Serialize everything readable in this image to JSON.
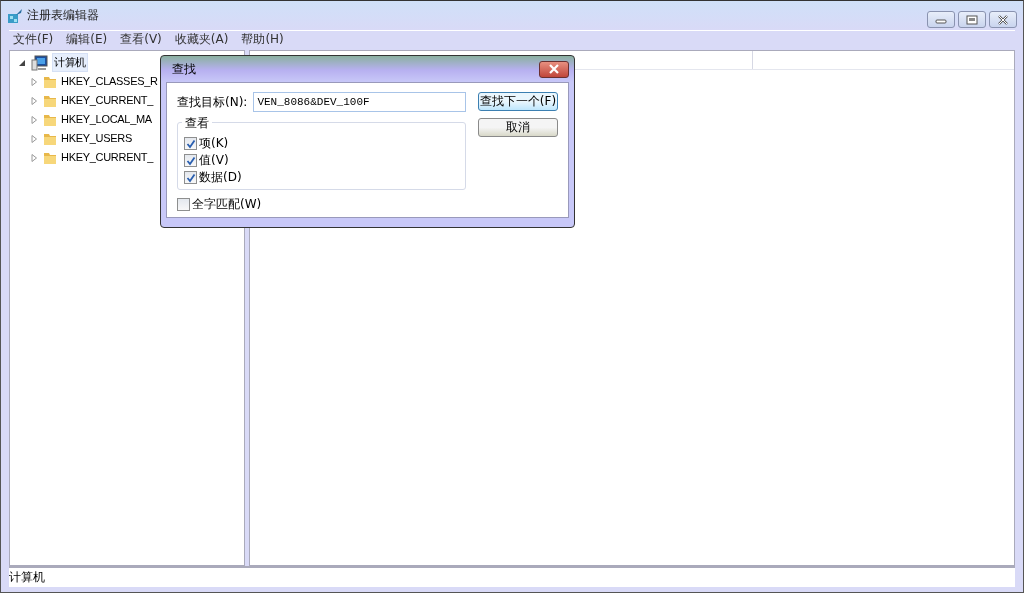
{
  "window": {
    "title": "注册表编辑器"
  },
  "menu": [
    "文件(F)",
    "编辑(E)",
    "查看(V)",
    "收藏夹(A)",
    "帮助(H)"
  ],
  "tree": [
    {
      "label": "计算机",
      "expanded": true,
      "selected": true,
      "children": [
        {
          "label": "HKEY_CLASSES_R",
          "expanded": false
        },
        {
          "label": "HKEY_CURRENT_",
          "expanded": false
        },
        {
          "label": "HKEY_LOCAL_MA",
          "expanded": false
        },
        {
          "label": "HKEY_USERS",
          "expanded": false
        },
        {
          "label": "HKEY_CURRENT_",
          "expanded": false
        }
      ]
    }
  ],
  "status_bar": "计算机",
  "dialog": {
    "title": "查找",
    "target_label": "查找目标(N):",
    "target_value": "VEN_8086&DEV_100F",
    "group_label": "查看",
    "options": [
      {
        "label": "项(K)",
        "checked": true
      },
      {
        "label": "值(V)",
        "checked": true
      },
      {
        "label": "数据(D)",
        "checked": true
      }
    ],
    "match_whole": {
      "label": "全字匹配(W)",
      "checked": false
    },
    "buttons": [
      {
        "label": "查找下一个(F)",
        "default": true
      },
      {
        "label": "取消",
        "default": false
      }
    ]
  }
}
